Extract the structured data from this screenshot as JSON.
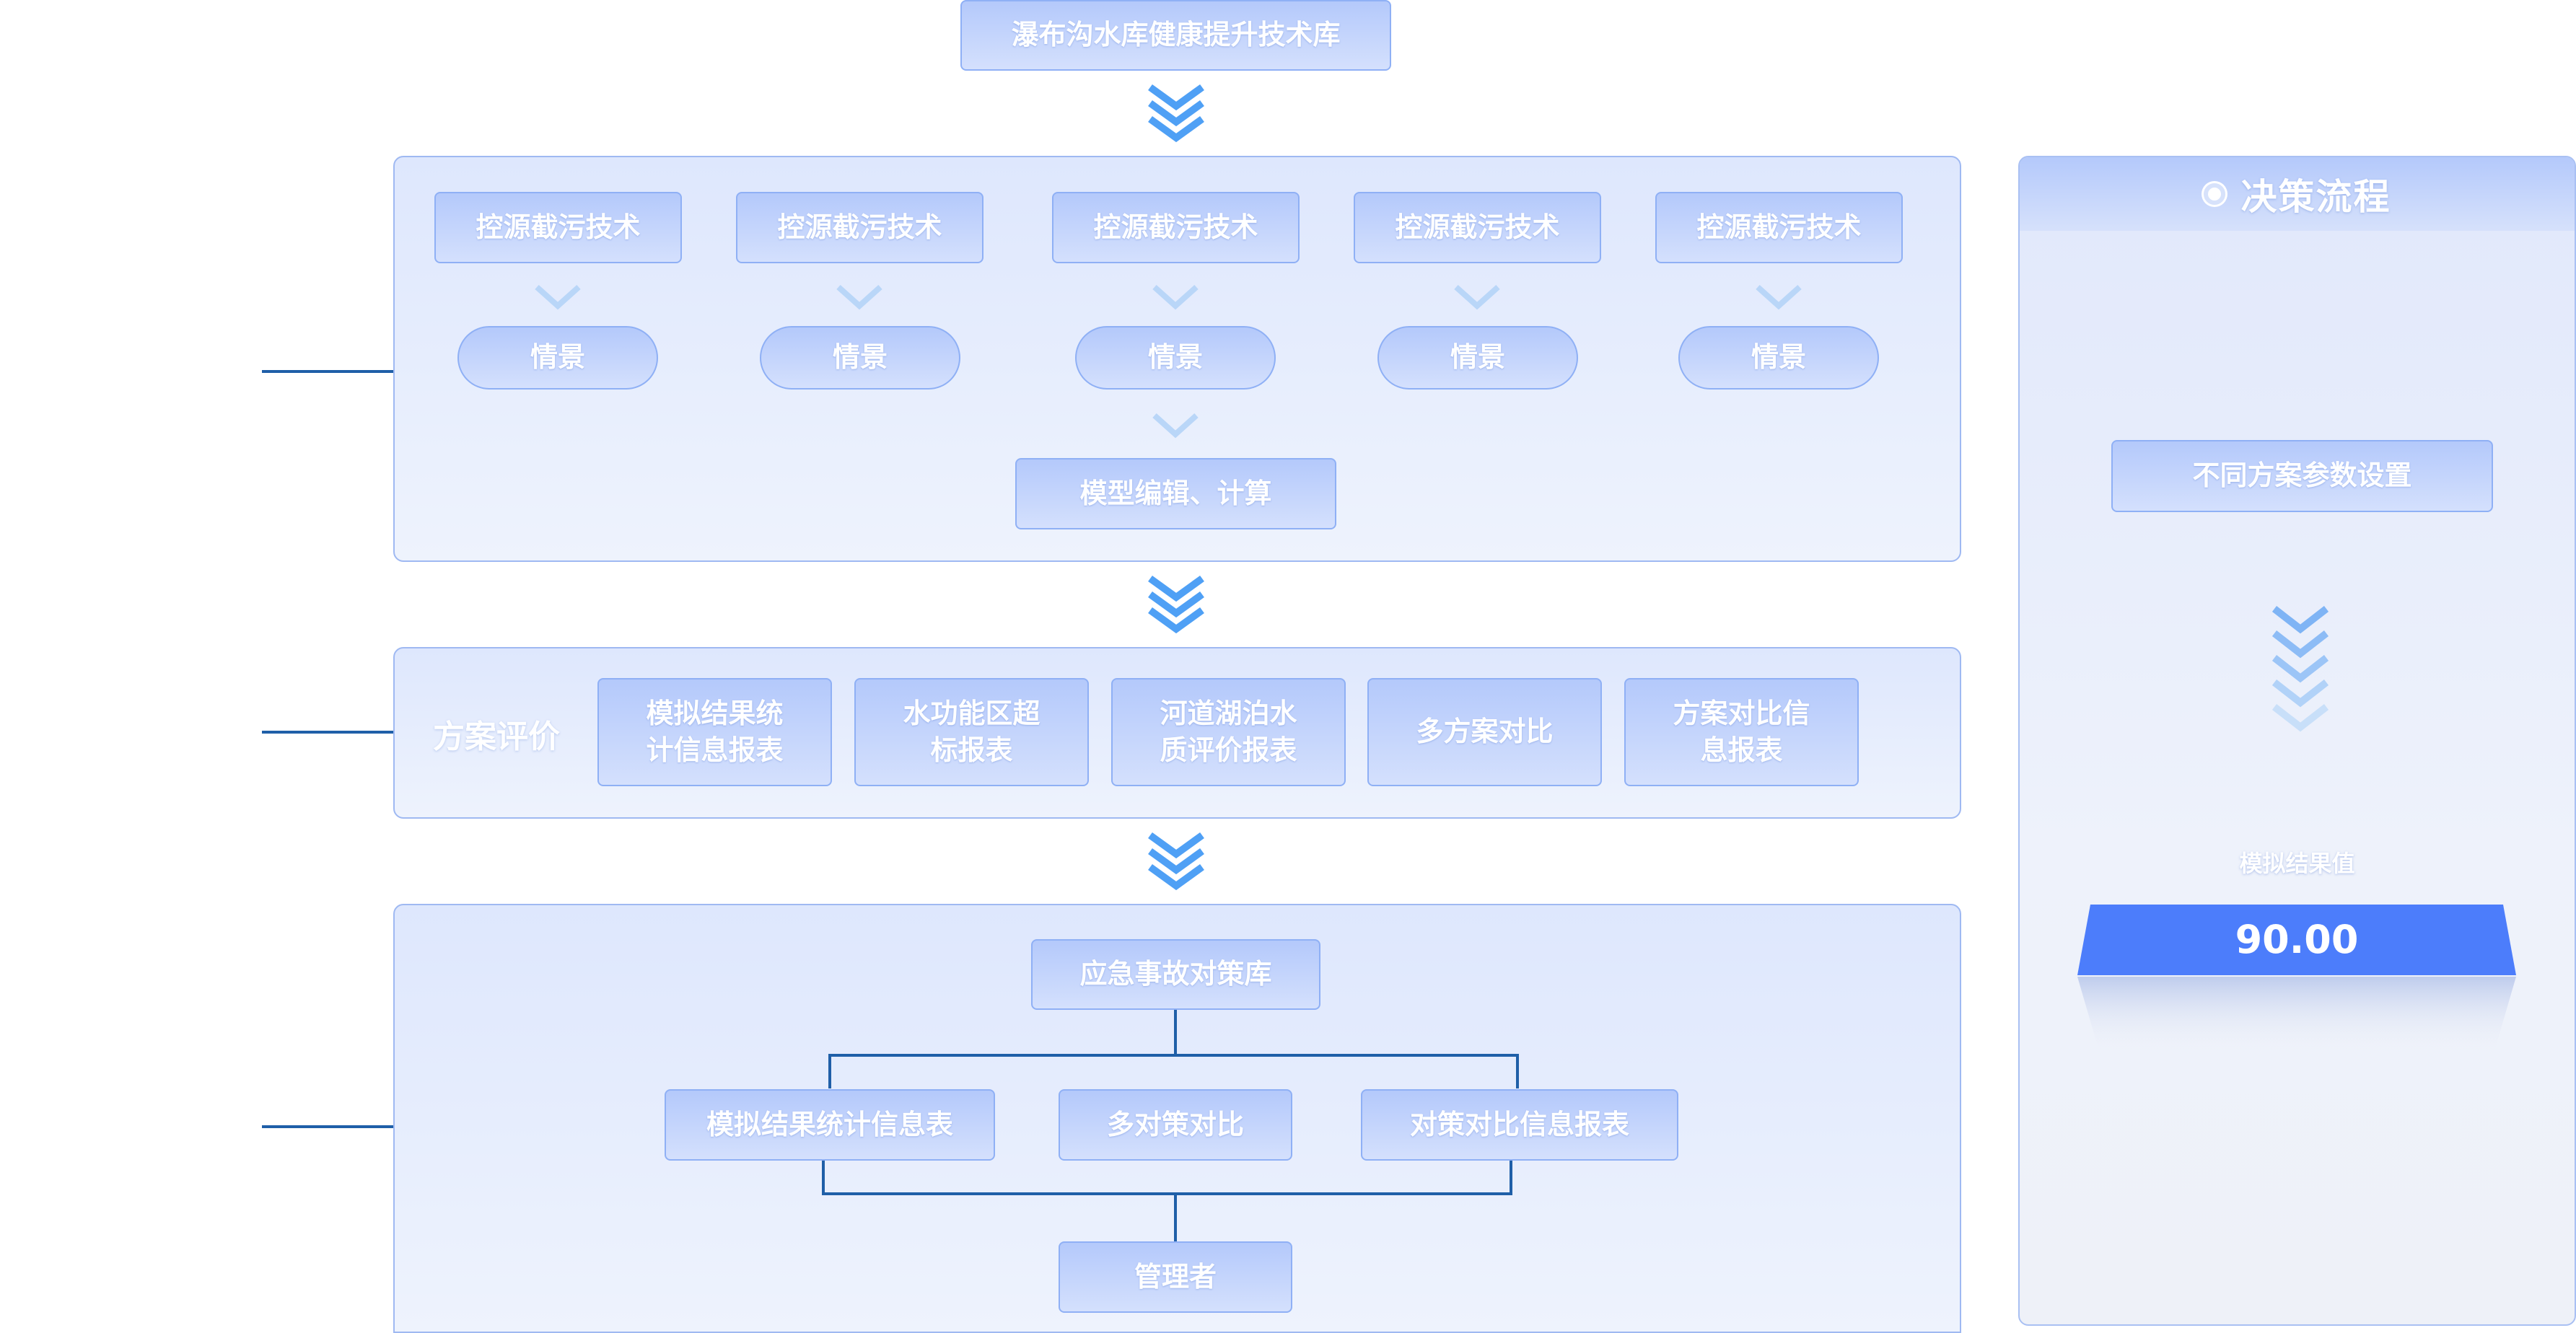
{
  "top_title": "瀑布沟水库健康提升技术库",
  "module1": {
    "techniques": [
      "控源截污技术",
      "控源截污技术",
      "控源截污技术",
      "控源截污技术",
      "控源截污技术"
    ],
    "scenarios": [
      "情景",
      "情景",
      "情景",
      "情景",
      "情景"
    ],
    "model_button": "模型编辑、计算"
  },
  "module2": {
    "label": "方案评价",
    "reports": [
      "模拟结果统\n计信息报表",
      "水功能区超\n标报表",
      "河道湖泊水\n质评价报表",
      "多方案对比",
      "方案对比信\n息报表"
    ]
  },
  "module3": {
    "root": "应急事故对策库",
    "items": [
      "模拟结果统计信息表",
      "多对策对比",
      "对策对比信息报表"
    ],
    "manager": "管理者"
  },
  "decision": {
    "title": "决策流程",
    "param_button": "不同方案参数设置",
    "result_label": "模拟结果值",
    "result_value": "90.00"
  },
  "colors": {
    "line": "#1f5fa8",
    "chevron": "#4fa0f5",
    "chevron_light": "#b9d6f8",
    "result_bg": "#4c7dfb"
  }
}
